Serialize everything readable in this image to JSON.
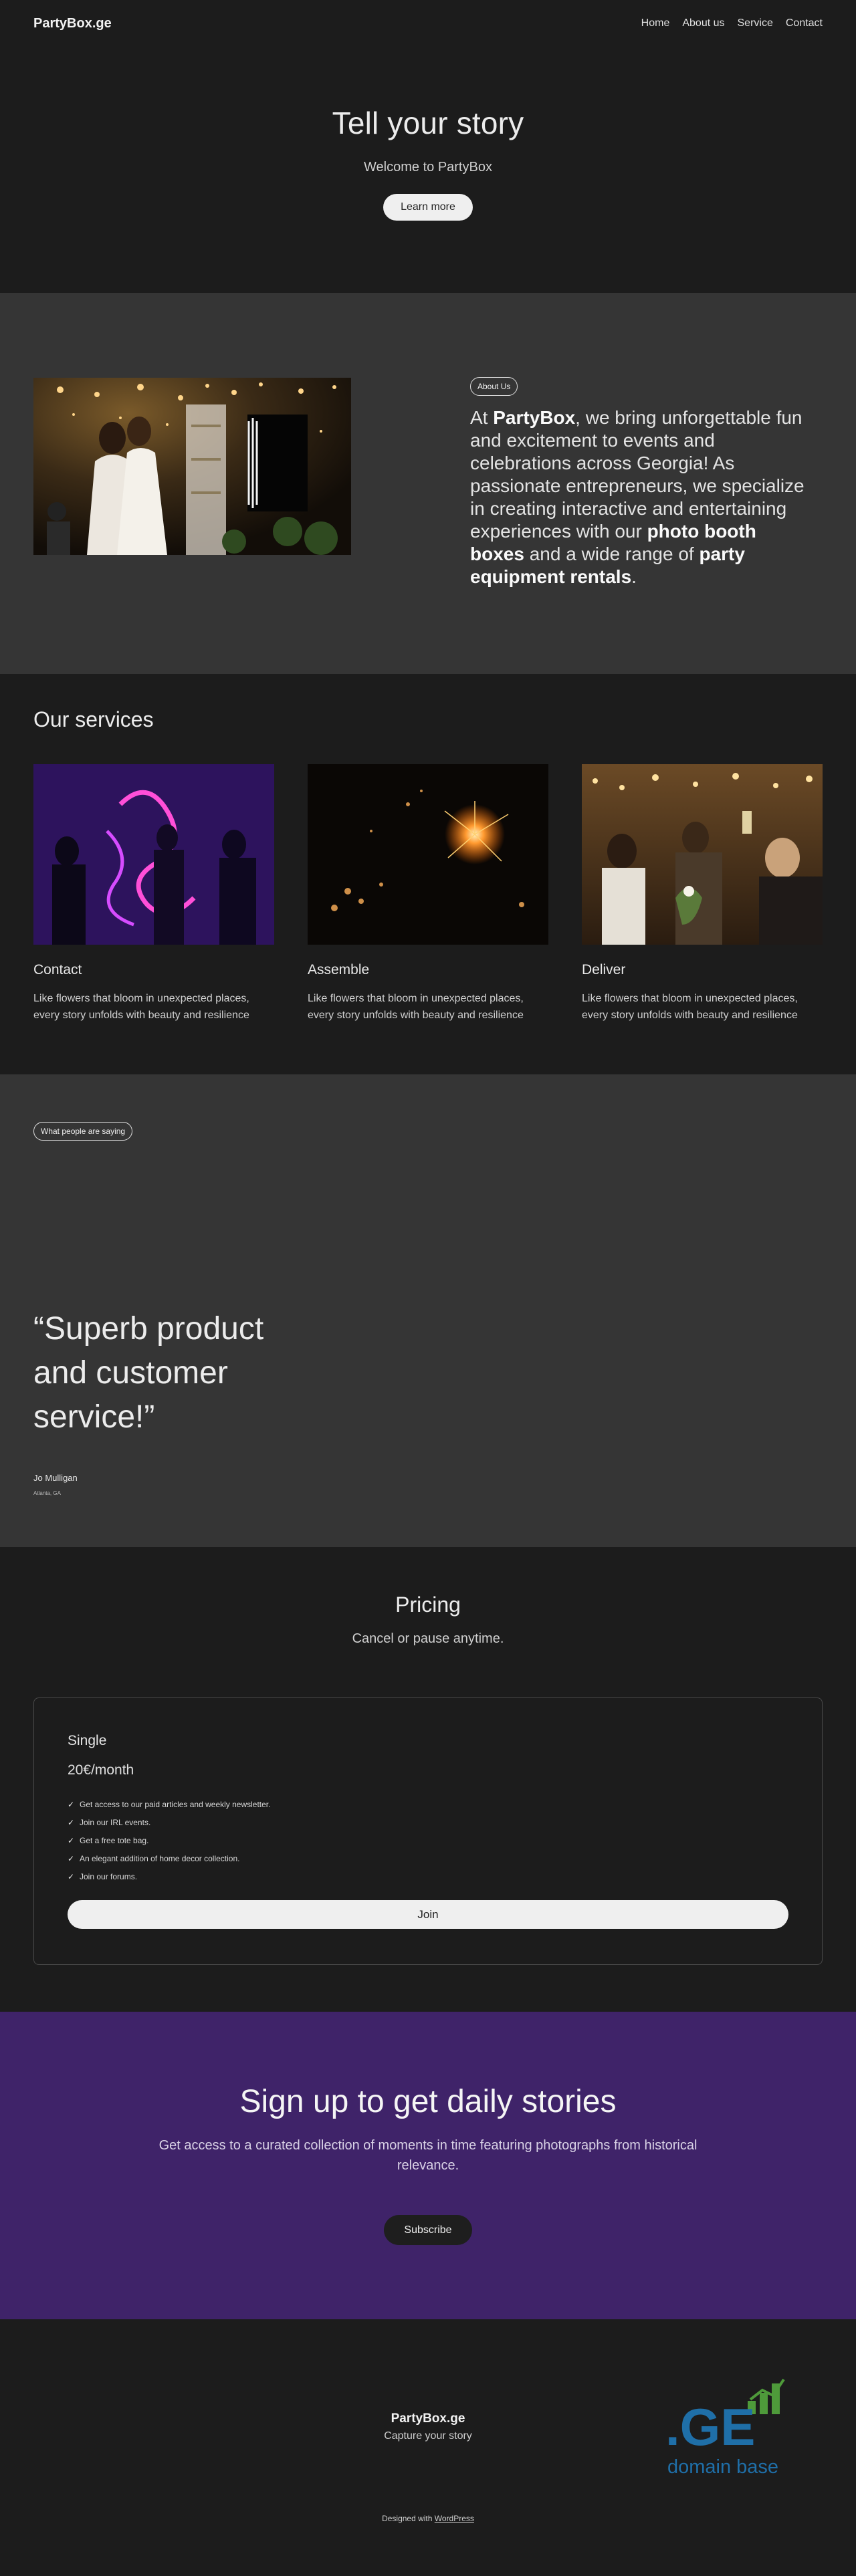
{
  "header": {
    "brand": "PartyBox.ge",
    "nav": [
      "Home",
      "About us",
      "Service",
      "Contact"
    ]
  },
  "hero": {
    "title": "Tell your story",
    "subtitle": "Welcome to PartyBox",
    "button": "Learn more"
  },
  "about": {
    "tag": "About Us",
    "parts": [
      "At ",
      "PartyBox",
      ", we bring unforgettable fun and excitement to events and celebrations across Georgia! As passionate entrepreneurs, we specialize in creating interactive and entertaining experiences with our ",
      "photo booth boxes",
      " and a wide range of ",
      "party equipment rentals",
      "."
    ]
  },
  "services": {
    "title": "Our services",
    "items": [
      {
        "title": "Contact",
        "text": "Like flowers that bloom in unexpected places, every story unfolds with beauty and resilience"
      },
      {
        "title": "Assemble",
        "text": "Like flowers that bloom in unexpected places, every story unfolds with beauty and resilience"
      },
      {
        "title": "Deliver",
        "text": "Like flowers that bloom in unexpected places, every story unfolds with beauty and resilience"
      }
    ]
  },
  "testimonial": {
    "tag": "What people are saying",
    "quote": "“Superb product and customer service!”",
    "author": "Jo Mulligan",
    "location": "Atlanta, GA"
  },
  "pricing": {
    "title": "Pricing",
    "subtitle": "Cancel or pause anytime.",
    "plan": {
      "name": "Single",
      "price": "20€/month",
      "features": [
        "Get access to our paid articles and weekly newsletter.",
        "Join our IRL events.",
        "Get a free tote bag.",
        "An elegant addition of home decor collection.",
        "Join our forums."
      ],
      "check": "✓",
      "button": "Join"
    }
  },
  "signup": {
    "title": "Sign up to get daily stories",
    "subtitle": "Get access to a curated collection of moments in time featuring photographs from historical relevance.",
    "button": "Subscribe"
  },
  "footer": {
    "brand": "PartyBox.ge",
    "tagline": "Capture your story",
    "credit_prefix": "Designed with ",
    "credit_link": "WordPress",
    "logo_text": ".GE",
    "logo_sub": "domain base"
  },
  "colors": {
    "background": "#1c1c1c",
    "alt_section": "#353535",
    "signup_bg": "#3f2369",
    "button_light": "#efefef",
    "logo_blue": "#1f6fa8",
    "logo_green": "#4e9a3a"
  }
}
